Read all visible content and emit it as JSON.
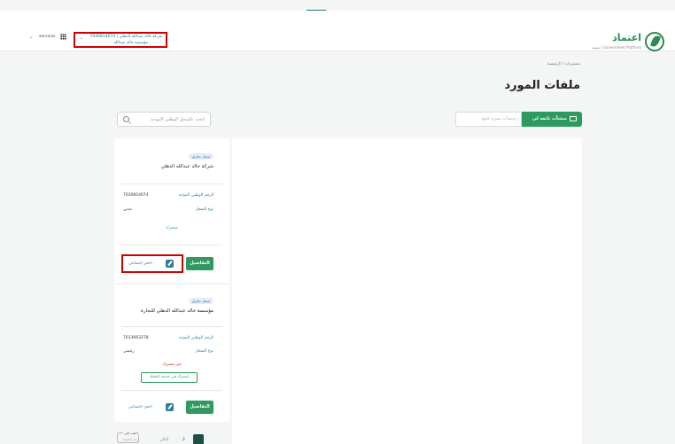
{
  "header": {
    "logo_name": "اعتماد",
    "logo_sub": "Government Platform | منصة",
    "entity_name": "شركة خالد عبدالله الدهلي | 7030814674",
    "entity_sub": "مؤسسة خالد عبدالله",
    "services_label": "services"
  },
  "breadcrumb": "مشتريات / الرئيسية",
  "page_title": "ملفات المورد",
  "search": {
    "placeholder": "ابحث بالسجل الوطني الموحد"
  },
  "tabs": {
    "active": "منشآت تابعة لي",
    "inactive": "منشآت مصرح عليها"
  },
  "cards": [
    {
      "badge": "سجل تجاري",
      "name": "شركة خالد عبدالله الدهلي",
      "unified_label": "الرقم الوطني الموحد",
      "unified_value": "7030814674",
      "type_label": "نوع السجل",
      "type_value": "مدني",
      "status": "مشترك",
      "details": "التفاصيل",
      "book": "احجز اجتماعي"
    },
    {
      "badge": "سجل تجاري",
      "name": "مؤسسة خالد عبدالله الدهلي للتجارة",
      "unified_label": "الرقم الوطني الموحد",
      "unified_value": "7013663278",
      "type_label": "نوع السجل",
      "type_value": "رئيسي",
      "status": "غير مشترك",
      "subscribe": "اشترك في خدمة اعتماد",
      "details": "التفاصيل",
      "book": "احجز اجتماعي"
    }
  ],
  "pagination": {
    "current": "1",
    "page2": "2",
    "next": "التالي",
    "goto_label": "اذهب إلى",
    "goto_placeholder": "رقم الصفحة"
  },
  "colors": {
    "primary": "#2e9a5f",
    "link": "#2e7d9a",
    "danger": "#d03030",
    "highlight": "#d10000"
  }
}
